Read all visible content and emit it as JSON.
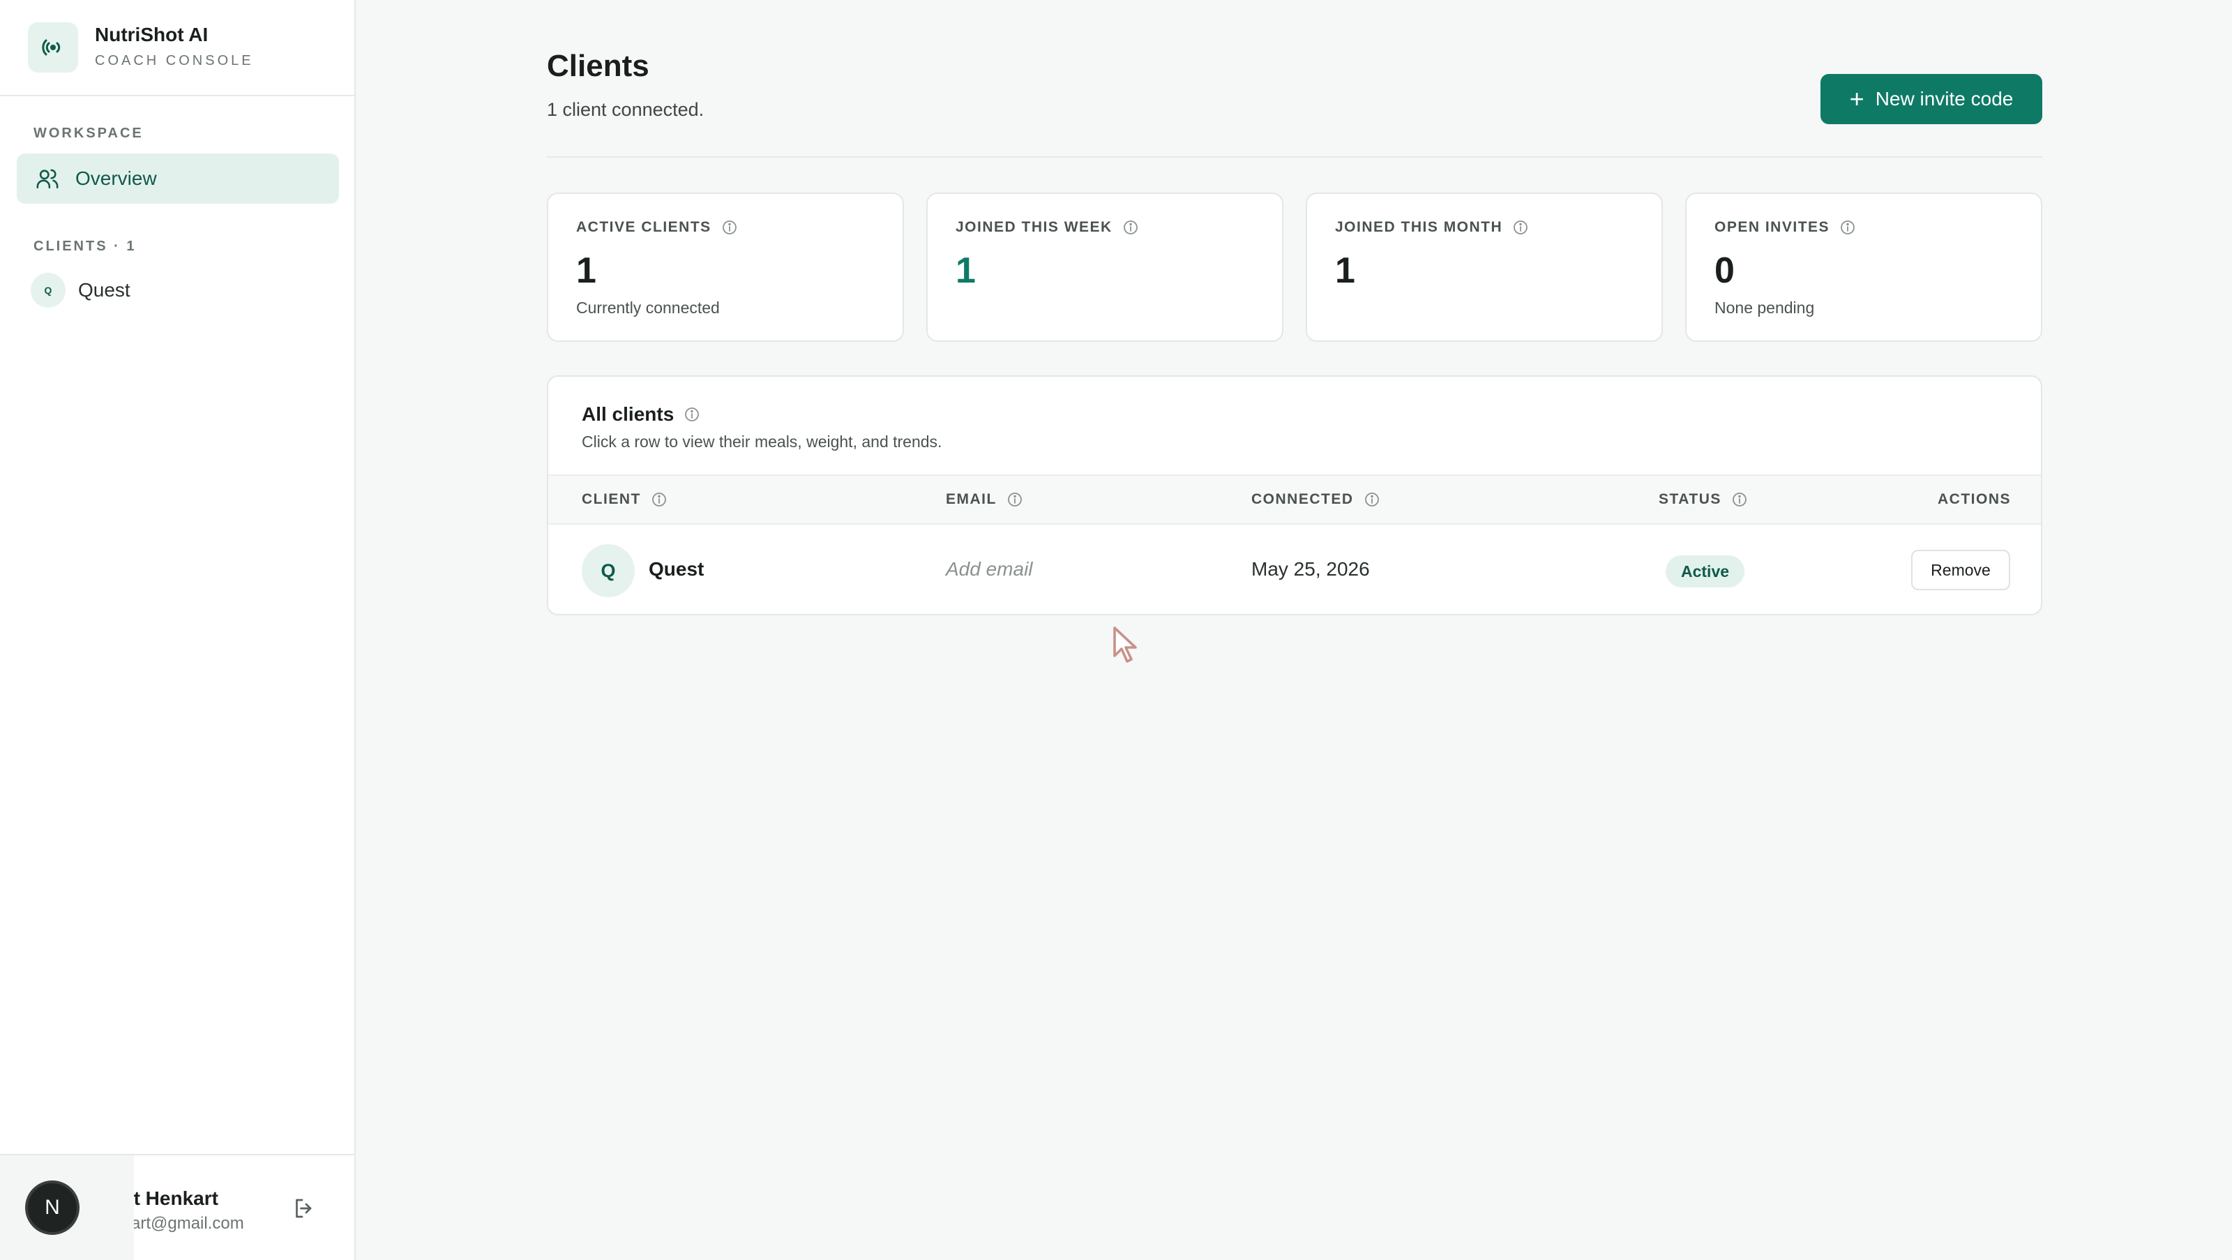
{
  "brand": {
    "name": "NutriShot AI",
    "subtitle": "COACH CONSOLE"
  },
  "sidebar": {
    "workspace_label": "WORKSPACE",
    "overview_label": "Overview",
    "clients_label": "CLIENTS · 1",
    "clients": [
      {
        "initial": "Q",
        "name": "Quest"
      }
    ]
  },
  "user": {
    "initial": "N",
    "name": "st Henkart",
    "email": "kart@gmail.com"
  },
  "header": {
    "title": "Clients",
    "subtitle": "1 client connected.",
    "new_invite_label": "New invite code"
  },
  "stats": [
    {
      "label": "ACTIVE CLIENTS",
      "value": "1",
      "note": "Currently connected"
    },
    {
      "label": "JOINED THIS WEEK",
      "value": "1",
      "note": ""
    },
    {
      "label": "JOINED THIS MONTH",
      "value": "1",
      "note": ""
    },
    {
      "label": "OPEN INVITES",
      "value": "0",
      "note": "None pending"
    }
  ],
  "table": {
    "title": "All clients",
    "subtitle": "Click a row to view their meals, weight, and trends.",
    "columns": {
      "client": "CLIENT",
      "email": "EMAIL",
      "connected": "CONNECTED",
      "status": "STATUS",
      "actions": "ACTIONS"
    },
    "rows": [
      {
        "initial": "Q",
        "name": "Quest",
        "email": "Add email",
        "connected": "May 25, 2026",
        "status": "Active",
        "action": "Remove"
      }
    ]
  },
  "colors": {
    "accent": "#0e7a66",
    "accent_soft": "#e3f1ed",
    "background": "#f6f7f7"
  }
}
